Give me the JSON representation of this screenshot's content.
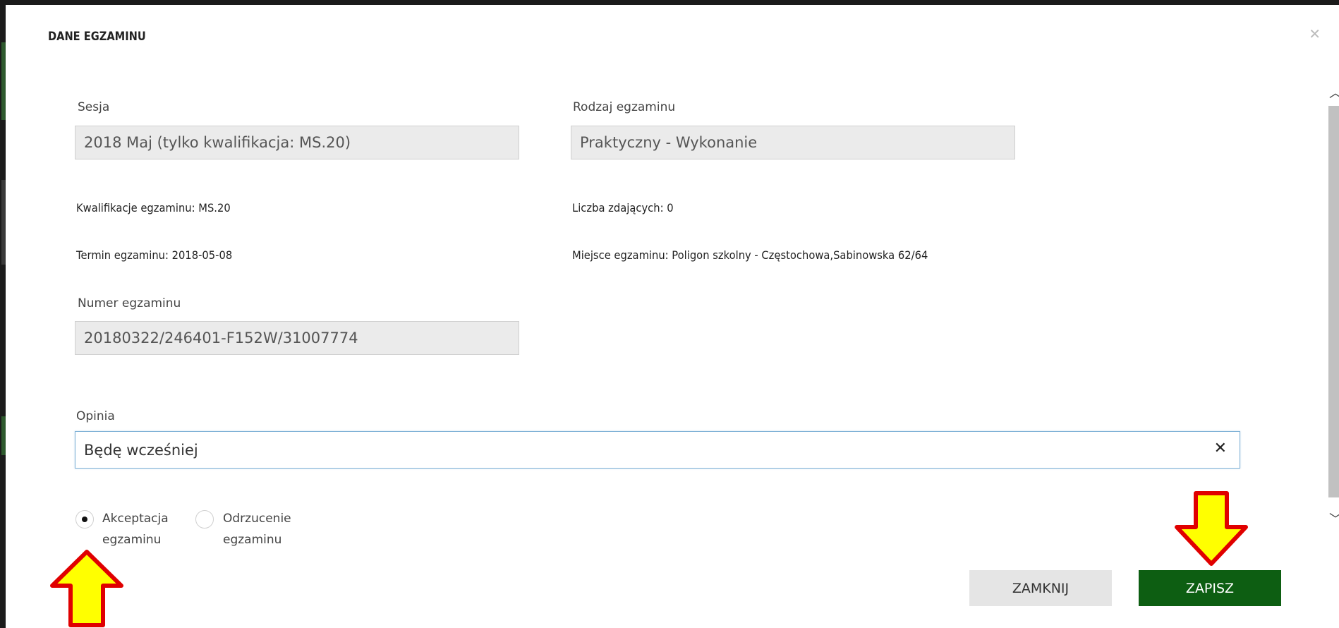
{
  "modal": {
    "title": "DANE EGZAMINU",
    "close_icon": "close-icon"
  },
  "form": {
    "sesja_label": "Sesja",
    "sesja_value": "2018 Maj (tylko kwalifikacja: MS.20)",
    "rodzaj_label": "Rodzaj egzaminu",
    "rodzaj_value": "Praktyczny - Wykonanie",
    "kwalifikacje": "Kwalifikacje egzaminu: MS.20",
    "liczba": "Liczba zdających: 0",
    "termin": "Termin egzaminu: 2018-05-08",
    "miejsce": "Miejsce egzaminu: Poligon szkolny - Częstochowa,Sabinowska 62/64",
    "numer_label": "Numer egzaminu",
    "numer_value": "20180322/246401-F152W/31007774",
    "opinia_label": "Opinia",
    "opinia_value": "Będę wcześniej"
  },
  "radios": {
    "accept_line1": "Akceptacja",
    "accept_line2": "egzaminu",
    "reject_line1": "Odrzucenie",
    "reject_line2": "egzaminu",
    "selected": "accept"
  },
  "buttons": {
    "close_label": "ZAMKNIJ",
    "save_label": "ZAPISZ"
  },
  "colors": {
    "save_bg": "#0d5e12",
    "arrow_fill": "#ffff00",
    "arrow_border": "#e00000"
  }
}
